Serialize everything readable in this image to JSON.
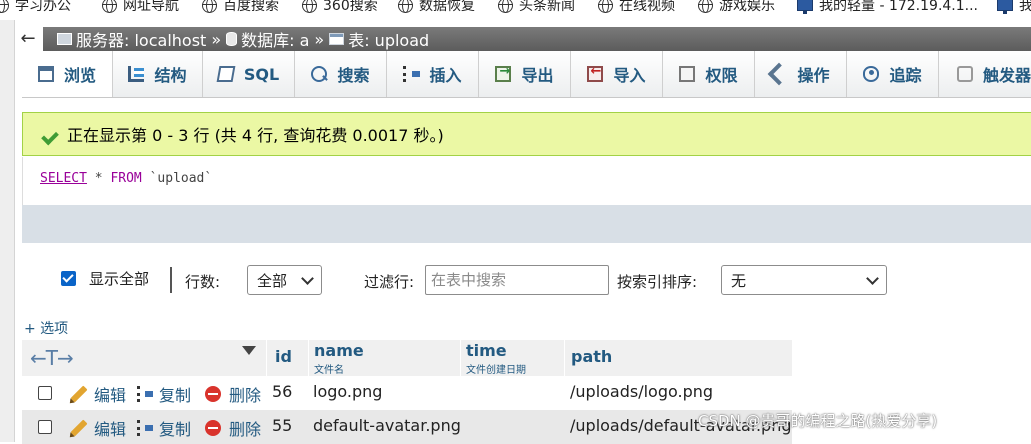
{
  "bookmarks": [
    "学习办公",
    "网址导航",
    "百度搜索",
    "360搜索",
    "数据恢复",
    "头条新闻",
    "在线视频",
    "游戏娱乐",
    "我的轻量 - 172.19.4.1...",
    "我"
  ],
  "breadcrumb": {
    "server_label": "服务器: localhost",
    "database_label": "数据库: a",
    "table_label": "表: upload",
    "separator": "»"
  },
  "tabs": [
    "浏览",
    "结构",
    "SQL",
    "搜索",
    "插入",
    "导出",
    "导入",
    "权限",
    "操作",
    "追踪",
    "触发器"
  ],
  "success_message": "正在显示第 0 - 3 行 (共 4 行, 查询花费 0.0017 秒。)",
  "sql": {
    "select": "SELECT",
    "star": " * ",
    "from": "FROM",
    "table": " `upload`"
  },
  "controls": {
    "show_all_label": "显示全部",
    "rows_label": "行数:",
    "rows_value": "全部",
    "filter_label": "过滤行:",
    "filter_placeholder": "在表中搜索",
    "sort_label": "按索引排序:",
    "sort_value": "无",
    "options_link": "+ 选项"
  },
  "table": {
    "arrows": "←T→",
    "columns": [
      {
        "name": "id",
        "comment": ""
      },
      {
        "name": "name",
        "comment": "文件名"
      },
      {
        "name": "time",
        "comment": "文件创建日期"
      },
      {
        "name": "path",
        "comment": ""
      }
    ],
    "actions": {
      "edit": "编辑",
      "copy": "复制",
      "delete": "删除"
    },
    "rows": [
      {
        "id": "56",
        "name": "logo.png",
        "path": "/uploads/logo.png"
      },
      {
        "id": "55",
        "name": "default-avatar.png",
        "path": "/uploads/default-avatar.png"
      }
    ]
  },
  "watermark": "CSDN @贵哥的编程之路(热爱分享)"
}
